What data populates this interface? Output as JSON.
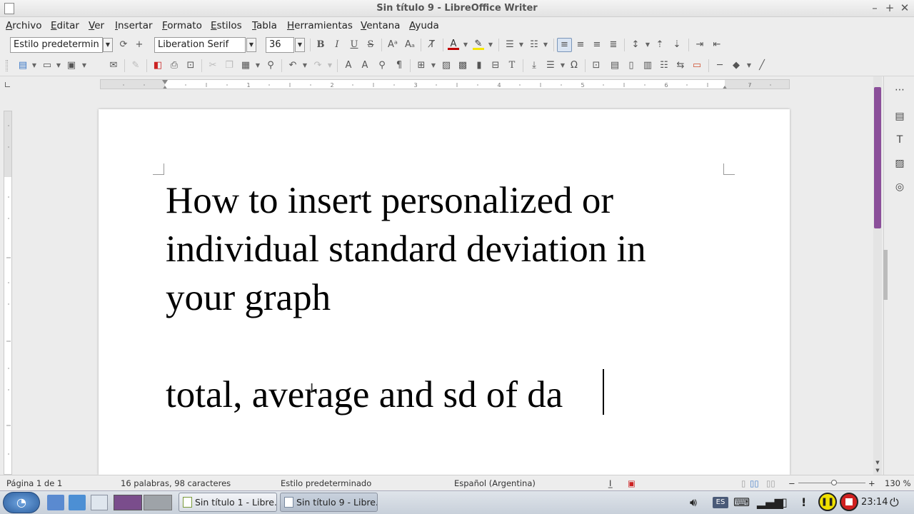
{
  "window": {
    "title": "Sin título 9 - LibreOffice Writer"
  },
  "menubar": {
    "items": [
      "Archivo",
      "Editar",
      "Ver",
      "Insertar",
      "Formato",
      "Estilos",
      "Tabla",
      "Herramientas",
      "Ventana",
      "Ayuda"
    ]
  },
  "formatting": {
    "paragraph_style": "Estilo predetermin",
    "font_name": "Liberation Serif",
    "font_size": "36"
  },
  "document": {
    "lines": [
      "How to insert personalized or",
      "individual standard deviation in",
      "your graph",
      "total, average and sd of da"
    ]
  },
  "status": {
    "page": "Página 1 de 1",
    "words": "16 palabras, 98 caracteres",
    "style": "Estilo predeterminado",
    "language": "Español (Argentina)",
    "zoom": "130 %"
  },
  "taskbar": {
    "tasks": [
      "Sin título 1 - Libre...",
      "Sin título 9 - Libre..."
    ],
    "keyboard_layout": "ES",
    "clock": "23:14"
  },
  "colors": {
    "accent": "#8b4f9a",
    "font_color": "#c00000",
    "highlight": "#f5e600"
  }
}
